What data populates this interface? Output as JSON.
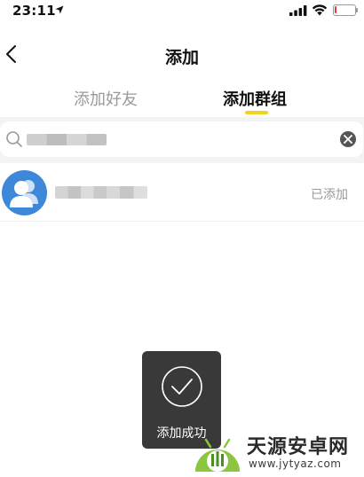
{
  "status_bar": {
    "time": "23:11",
    "battery_level": 0.1,
    "battery_color": "#e53935"
  },
  "nav": {
    "title": "添加",
    "back_icon": "chevron-left-icon"
  },
  "tabs": [
    {
      "label": "添加好友",
      "active": false
    },
    {
      "label": "添加群组",
      "active": true
    }
  ],
  "accent_color": "#f7d01c",
  "search": {
    "search_icon": "search-icon",
    "clear_icon": "clear-icon",
    "query_redacted": true
  },
  "results": [
    {
      "name_redacted": true,
      "avatar_icon": "group-avatar-icon",
      "avatar_color": "#3d88d9",
      "status": "已添加"
    }
  ],
  "toast": {
    "icon": "check-circle-icon",
    "message": "添加成功"
  },
  "watermark": {
    "title": "天源安卓网",
    "url": "www.jytyaz.com"
  }
}
